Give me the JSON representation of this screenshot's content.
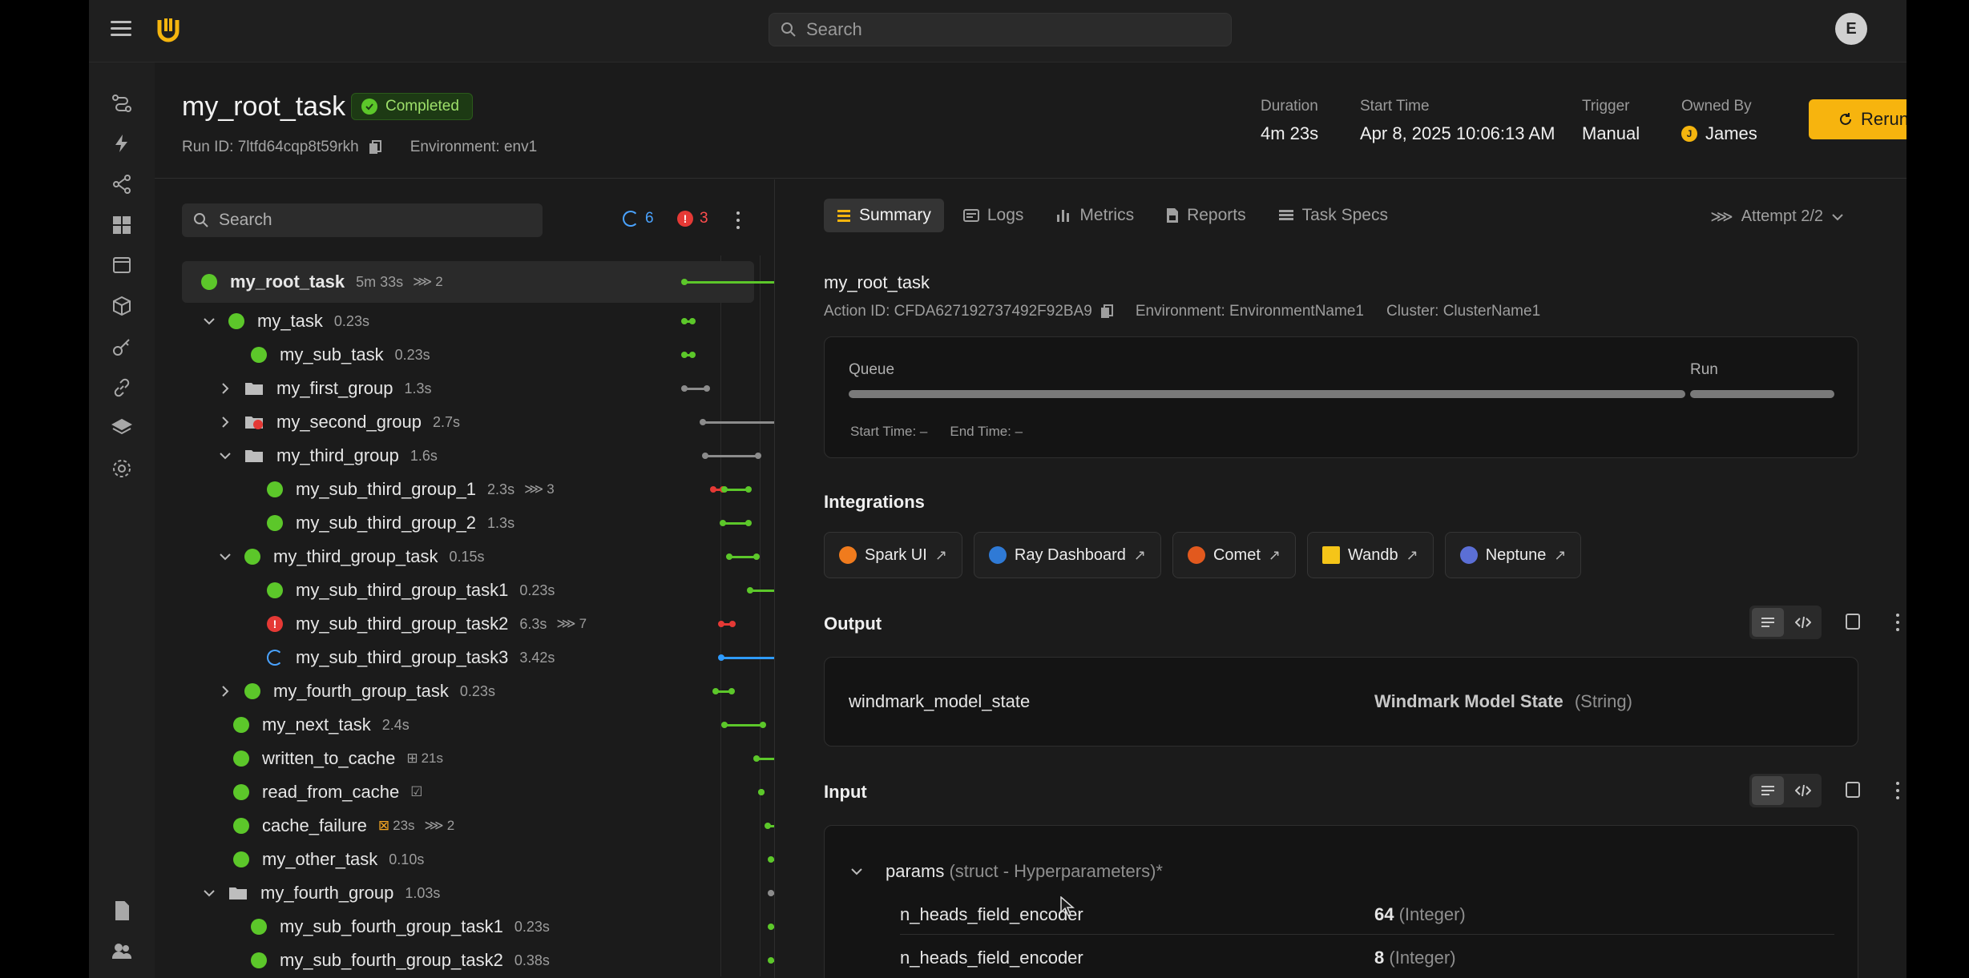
{
  "search": {
    "placeholder": "Search"
  },
  "user": {
    "initial": "E"
  },
  "header": {
    "title": "my_root_task",
    "status": "Completed",
    "run_id": "Run ID: 7ltfd64cqp8t59rkh",
    "environment": "Environment: env1",
    "duration_label": "Duration",
    "duration": "4m 23s",
    "start_label": "Start Time",
    "start": "Apr 8, 2025 10:06:13 AM",
    "trigger_label": "Trigger",
    "trigger": "Manual",
    "owner_label": "Owned By",
    "owner": "James",
    "owner_initial": "J",
    "rerun_label": "Rerun"
  },
  "tasks": {
    "search_placeholder": "Search",
    "running_count": "6",
    "error_count": "3",
    "rows": [
      {
        "name": "my_root_task",
        "dur": "5m 33s",
        "extra": "2"
      },
      {
        "name": "my_task",
        "dur": "0.23s"
      },
      {
        "name": "my_sub_task",
        "dur": "0.23s"
      },
      {
        "name": "my_first_group",
        "dur": "1.3s"
      },
      {
        "name": "my_second_group",
        "dur": "2.7s"
      },
      {
        "name": "my_third_group",
        "dur": "1.6s"
      },
      {
        "name": "my_sub_third_group_1",
        "dur": "2.3s",
        "extra": "3"
      },
      {
        "name": "my_sub_third_group_2",
        "dur": "1.3s"
      },
      {
        "name": "my_third_group_task",
        "dur": "0.15s"
      },
      {
        "name": "my_sub_third_group_task1",
        "dur": "0.23s"
      },
      {
        "name": "my_sub_third_group_task2",
        "dur": "6.3s",
        "extra": "7"
      },
      {
        "name": "my_sub_third_group_task3",
        "dur": "3.42s"
      },
      {
        "name": "my_fourth_group_task",
        "dur": "0.23s"
      },
      {
        "name": "my_next_task",
        "dur": "2.4s"
      },
      {
        "name": "written_to_cache",
        "dur": "21s"
      },
      {
        "name": "read_from_cache",
        "dur": ""
      },
      {
        "name": "cache_failure",
        "dur": "23s",
        "extra": "2"
      },
      {
        "name": "my_other_task",
        "dur": "0.10s"
      },
      {
        "name": "my_fourth_group",
        "dur": "1.03s"
      },
      {
        "name": "my_sub_fourth_group_task1",
        "dur": "0.23s"
      },
      {
        "name": "my_sub_fourth_group_task2",
        "dur": "0.38s"
      }
    ]
  },
  "detail": {
    "tabs": [
      "Summary",
      "Logs",
      "Metrics",
      "Reports",
      "Task Specs"
    ],
    "attempt": "Attempt 2/2",
    "title": "my_root_task",
    "action_id": "Action ID: CFDA627192737492F92BA9",
    "environment": "Environment: EnvironmentName1",
    "cluster": "Cluster: ClusterName1",
    "queue_label": "Queue",
    "run_label": "Run",
    "start_time": "Start Time: –",
    "end_time": "End Time: –",
    "integrations_title": "Integrations",
    "integrations": [
      "Spark UI",
      "Ray Dashboard",
      "Comet",
      "Wandb",
      "Neptune"
    ],
    "output_title": "Output",
    "output_key": "windmark_model_state",
    "output_name": "Windmark Model State",
    "output_type": "(String)",
    "input_title": "Input",
    "params_name": "params",
    "params_type": "(struct - Hyperparameters)*",
    "inputs": [
      {
        "key": "n_heads_field_encoder",
        "value": "64",
        "type": "(Integer)"
      },
      {
        "key": "n_heads_field_encoder",
        "value": "8",
        "type": "(Integer)"
      }
    ]
  },
  "colors": {
    "accent": "#f7b40e",
    "success": "#5cc72a",
    "error": "#e53935",
    "running": "#2e9bff"
  }
}
